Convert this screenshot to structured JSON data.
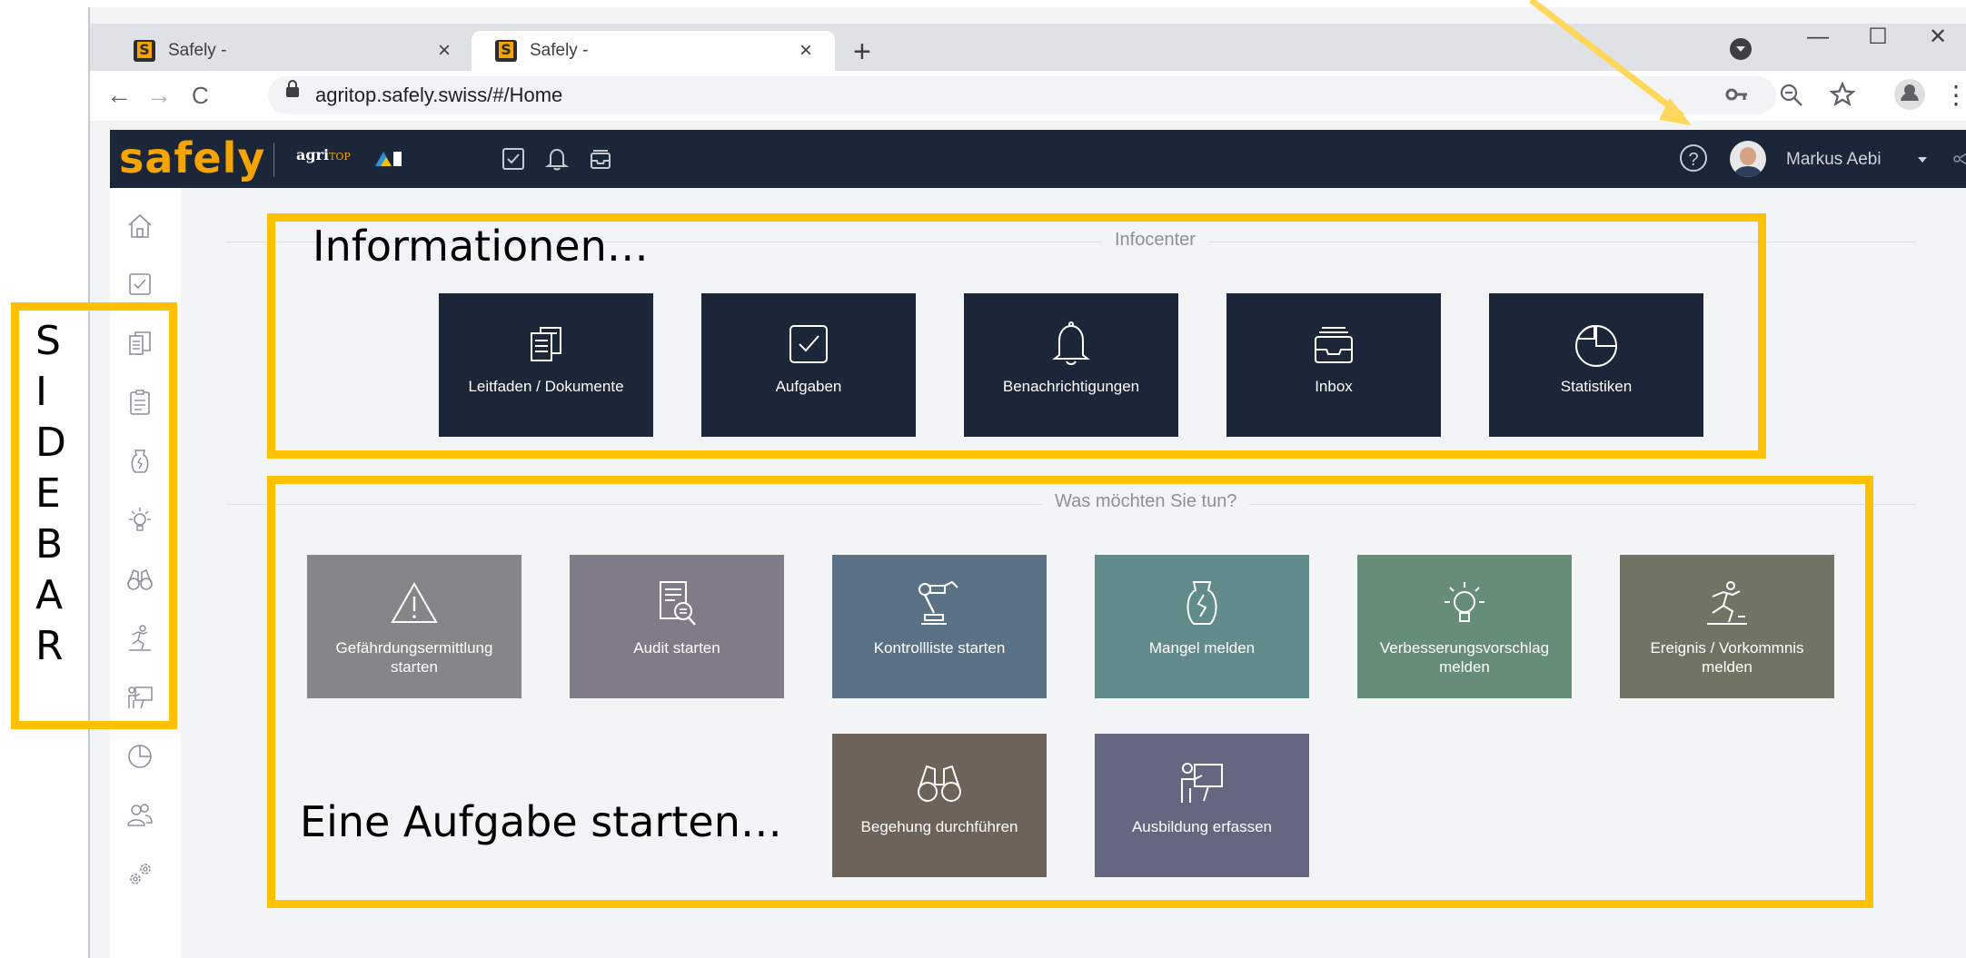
{
  "annotation": {
    "sidebar_letters": [
      "S",
      "I",
      "D",
      "E",
      "B",
      "A",
      "R"
    ],
    "info_label": "Informationen…",
    "task_label": "Eine Aufgabe starten…",
    "highlight_color": "#FFC000"
  },
  "browser": {
    "tabs": [
      {
        "title": "Safely -",
        "close": "×",
        "active": false
      },
      {
        "title": "Safely -",
        "close": "×",
        "active": true
      }
    ],
    "new_tab": "+",
    "window_controls": {
      "minimize": "—",
      "maximize": "☐",
      "close": "✕"
    },
    "nav": {
      "back": "←",
      "forward": "→",
      "reload": "C"
    },
    "url": "agritop.safely.swiss/#/Home",
    "omnibox_icons": [
      "key-icon",
      "zoom-icon",
      "star-icon"
    ],
    "menu": "⋮"
  },
  "header": {
    "logo": "safely",
    "partner": {
      "name": "agri",
      "suffix": "TOP"
    },
    "icons": [
      "checkbox-icon",
      "bell-icon",
      "inbox-icon"
    ],
    "help": "?",
    "user_name": "Markus Aebi",
    "colors": {
      "background": "#1b2638",
      "brand": "#f5a400"
    }
  },
  "sidebar": {
    "items": [
      "home-icon",
      "task-icon",
      "documents-icon",
      "checklist-icon",
      "defect-icon",
      "idea-icon",
      "binoculars-icon",
      "incident-icon",
      "training-icon",
      "statistics-icon",
      "users-icon",
      "settings-icon"
    ]
  },
  "infocenter": {
    "title": "Infocenter",
    "tiles": [
      {
        "label": "Leitfaden / Dokumente",
        "icon": "documents-icon"
      },
      {
        "label": "Aufgaben",
        "icon": "checkbox-icon"
      },
      {
        "label": "Benachrichtigungen",
        "icon": "bell-icon"
      },
      {
        "label": "Inbox",
        "icon": "inbox-icon"
      },
      {
        "label": "Statistiken",
        "icon": "pie-chart-icon"
      }
    ]
  },
  "actions": {
    "title": "Was möchten Sie tun?",
    "tiles": [
      {
        "label": "Gefährdungsermittlung starten",
        "color": "#858687",
        "icon": "warning-icon"
      },
      {
        "label": "Audit starten",
        "color": "#807b89",
        "icon": "audit-icon"
      },
      {
        "label": "Kontrollliste starten",
        "color": "#5a7186",
        "icon": "robot-arm-icon"
      },
      {
        "label": "Mangel melden",
        "color": "#628b8c",
        "icon": "defect-vase-icon"
      },
      {
        "label": "Verbesserungsvorschlag melden",
        "color": "#668d78",
        "icon": "lightbulb-icon"
      },
      {
        "label": "Ereignis / Vorkommnis melden",
        "color": "#6e7663",
        "icon": "fall-incident-icon"
      },
      {
        "label": "Begehung durchführen",
        "color": "#6d6358",
        "icon": "binoculars-icon"
      },
      {
        "label": "Ausbildung erfassen",
        "color": "#656780",
        "icon": "teacher-icon"
      }
    ]
  }
}
